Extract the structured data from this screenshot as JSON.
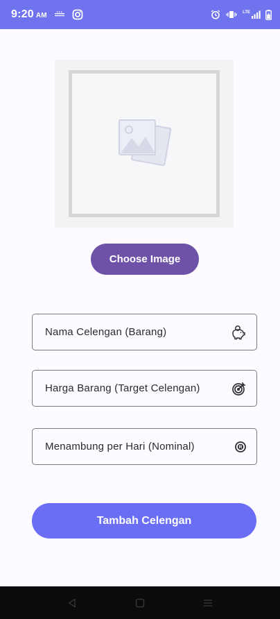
{
  "status_bar": {
    "time": "9:20",
    "ampm": "AM",
    "left_icons": [
      "keyboard-icon",
      "instagram-icon"
    ],
    "right_icons": [
      "alarm-icon",
      "vibrate-icon",
      "lte-signal-icon",
      "battery-icon"
    ],
    "network_label": "LTE"
  },
  "image_picker": {
    "placeholder_icon": "image-placeholder-icon",
    "button_label": "Choose Image"
  },
  "form": {
    "fields": [
      {
        "label": "Nama Celengan (Barang)",
        "icon": "piggy-bank-icon"
      },
      {
        "label": "Harga Barang (Target Celengan)",
        "icon": "target-icon"
      },
      {
        "label": "Menambung per Hari (Nominal)",
        "icon": "coin-icon"
      }
    ],
    "submit_label": "Tambah Celengan"
  },
  "navigation": {
    "buttons": [
      "back-icon",
      "home-icon",
      "menu-icon"
    ]
  },
  "colors": {
    "status_bar": "#6f73ee",
    "choose_button": "#6d52a8",
    "submit_button": "#6a6ef4",
    "background": "#fdfbff"
  }
}
